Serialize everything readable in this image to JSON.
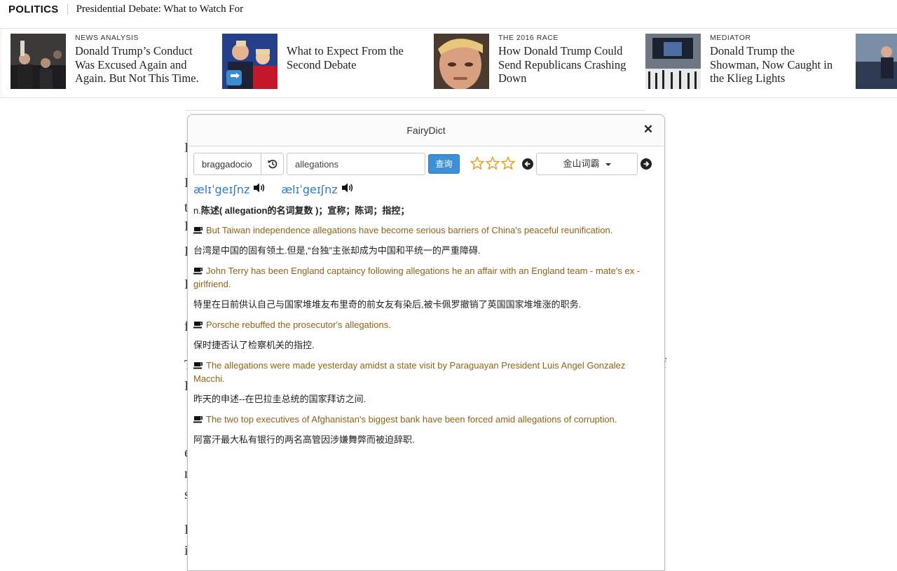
{
  "topbar": {
    "section": "POLITICS",
    "headline": "Presidential Debate: What to Watch For"
  },
  "stories": [
    {
      "kicker": "NEWS ANALYSIS",
      "title": "Donald Trump’s Conduct Was Excused Again and Again. But Not This Time."
    },
    {
      "kicker": "",
      "title": "What to Expect From the Second Debate"
    },
    {
      "kicker": "THE 2016 RACE",
      "title": "How Donald Trump Could Send Republicans Crashing Down"
    },
    {
      "kicker": "MEDIATOR",
      "title": "Donald Trump the Showman, Now Caught in the Klieg Lights"
    }
  ],
  "dict": {
    "title": "FairyDict",
    "history_value": "braggadocio",
    "search_value": "allegations",
    "query_label": "查询",
    "rating": 0,
    "dictionary": "金山词霸",
    "phonetics": [
      "ælɪˈgeɪʃnz",
      "ælɪˈgeɪʃnz"
    ],
    "definition_pos": "n.",
    "definition_text": "陈述( allegation的名词复数 )；宣称；陈词；指控；",
    "examples": [
      {
        "en": "But Taiwan independence allegations have become serious barriers of China's peaceful reunification.",
        "zh": "台湾是中国的固有领土.但是,“台独”主张却成为中国和平统一的严重障碍."
      },
      {
        "en": "John Terry has been England captaincy following allegations he an affair with an England team - mate's ex - girlfriend.",
        "zh": "特里在日前供认自己与国家堆堆友布里奇的前女友有染后,被卡佩罗撤销了英国国家堆堆涨的职务."
      },
      {
        "en": "Porsche rebuffed the prosecutor's allegations.",
        "zh": "保时捷否认了检察机关的指控."
      },
      {
        "en": "The allegations were made yesterday amidst a state visit by Paraguayan President Luis Angel Gonzalez Macchi.",
        "zh": "昨天的申述--在巴拉圭总统的国家拜访之间."
      },
      {
        "en": "The two top executives of Afghanistan's biggest bank have been forced amid allegations of corruption.",
        "zh": "阿富汗最大私有银行的两名高管因涉嫌舞弊而被迫辞职."
      }
    ]
  }
}
